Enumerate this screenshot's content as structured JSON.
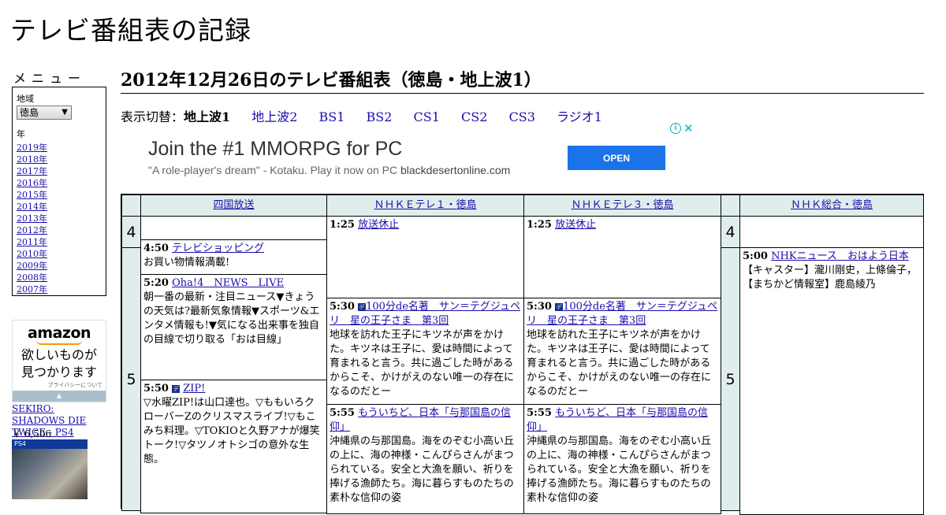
{
  "site": {
    "title": "テレビ番組表の記録"
  },
  "sidebar": {
    "menu_heading": "メニュー",
    "region_label": "地域",
    "region_value": "徳島",
    "year_label": "年",
    "years": [
      "2019年",
      "2018年",
      "2017年",
      "2016年",
      "2015年",
      "2014年",
      "2013年",
      "2012年",
      "2011年",
      "2010年",
      "2009年",
      "2008年",
      "2007年"
    ]
  },
  "amazon_ad": {
    "logo": "amazon",
    "message_line1": "欲しいものが",
    "message_line2": "見つかります",
    "privacy": "プライバシーについて",
    "product_name": "SEKIRO: SHADOWS DIE TWICE - PS4",
    "price": "￥ 6,506",
    "platform": "PS4"
  },
  "main": {
    "title": "2012年12月26日のテレビ番組表（徳島・地上波1）",
    "switch_label": "表示切替：",
    "current_tab": "地上波1",
    "tabs": [
      "地上波2",
      "BS1",
      "BS2",
      "CS1",
      "CS2",
      "CS3",
      "ラジオ1"
    ]
  },
  "banner_ad": {
    "headline": "Join the #1 MMORPG for PC",
    "subline": "\"A role-player's dream\" - Kotaku. Play it now on PC",
    "domain": "blackdesertonline.com",
    "button": "OPEN",
    "info_icon": "info-icon",
    "close_icon": "close-icon"
  },
  "schedule": {
    "channels": [
      "四国放送",
      "ＮＨＫＥテレ１・徳島",
      "ＮＨＫＥテレ３・徳島",
      "ＮＨＫ総合・徳島"
    ],
    "hours": [
      "4",
      "5"
    ],
    "col1": [
      {
        "time": "4:50",
        "title": "テレビショッピング",
        "desc": "お買い物情報満載!"
      },
      {
        "time": "5:20",
        "title": "Oha!4　NEWS　LIVE",
        "desc": "朝一番の最新・注目ニュース▼きょうの天気は?最新気象情報▼スポーツ&エンタメ情報も!▼気になる出来事を独自の目線で切り取る「おは目線」"
      },
      {
        "time": "5:50",
        "title": "ZIP!",
        "desc": "▽水曜ZIP!は山口達也。▽ももいろクローバーZのクリスマスライブ!▽もこみち料理。▽TOKIOと久野アナが爆笑トーク!▽タツノオトシゴの意外な生態。"
      }
    ],
    "col2": [
      {
        "time": "1:25",
        "title": "放送休止"
      },
      {
        "time": "5:30",
        "title": "100分de名著　サン＝テグジュペリ　星の王子さま　第3回",
        "desc": "地球を訪れた王子にキツネが声をかけた。キツネは王子に、愛は時間によって育まれると言う。共に過ごした時があるからこそ、かけがえのない唯一の存在になるのだとー"
      },
      {
        "time": "5:55",
        "title": "もういちど、日本「与那国島の信仰」",
        "desc": "沖縄県の与那国島。海をのぞむ小高い丘の上に、海の神様・こんぴらさんがまつられている。安全と大漁を願い、祈りを捧げる漁師たち。海に暮らすものたちの素朴な信仰の姿"
      }
    ],
    "col3": [
      {
        "time": "1:25",
        "title": "放送休止"
      },
      {
        "time": "5:30",
        "title": "100分de名著　サン＝テグジュペリ　星の王子さま　第3回",
        "desc": "地球を訪れた王子にキツネが声をかけた。キツネは王子に、愛は時間によって育まれると言う。共に過ごした時があるからこそ、かけがえのない唯一の存在になるのだとー"
      },
      {
        "time": "5:55",
        "title": "もういちど、日本「与那国島の信仰」",
        "desc": "沖縄県の与那国島。海をのぞむ小高い丘の上に、海の神様・こんぴらさんがまつられている。安全と大漁を願い、祈りを捧げる漁師たち。海に暮らすものたちの素朴な信仰の姿"
      }
    ],
    "col4": [
      {
        "time": "5:00",
        "title": "NHKニュース　おはよう日本",
        "desc": "【キャスター】瀧川剛史，上條倫子，【まちかど情報室】鹿島綾乃"
      }
    ],
    "data_icon_label": "デ"
  }
}
